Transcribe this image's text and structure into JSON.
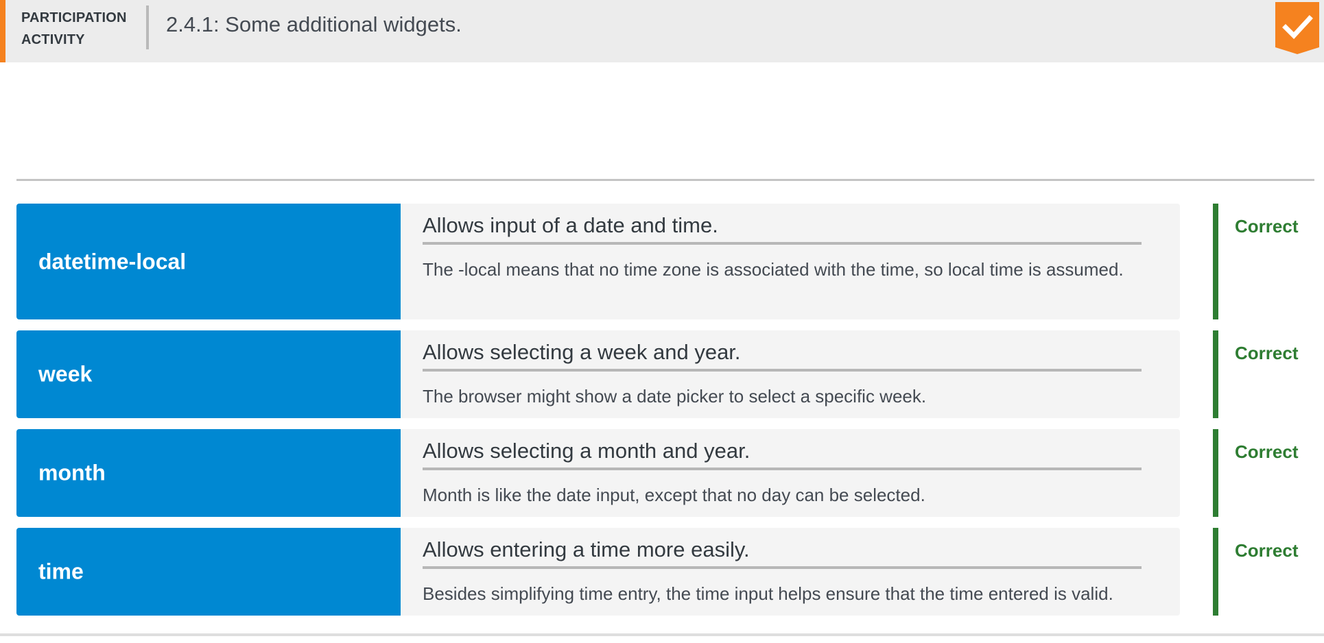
{
  "header": {
    "activity_label": "PARTICIPATION ACTIVITY",
    "title": "2.4.1: Some additional widgets.",
    "completion_icon": "checkmark-icon",
    "accent_color": "#f5821f"
  },
  "colors": {
    "term_background": "#0088d2",
    "definition_background": "#f4f4f4",
    "correct": "#2e7d32"
  },
  "matches": [
    {
      "term": "datetime-local",
      "definition": "Allows input of a date and time.",
      "explanation": "The -local means that no time zone is associated with the time, so local time is assumed.",
      "status": "Correct"
    },
    {
      "term": "week",
      "definition": "Allows selecting a week and year.",
      "explanation": "The browser might show a date picker to select a specific week.",
      "status": "Correct"
    },
    {
      "term": "month",
      "definition": "Allows selecting a month and year.",
      "explanation": "Month is like the date input, except that no day can be selected.",
      "status": "Correct"
    },
    {
      "term": "time",
      "definition": "Allows entering a time more easily.",
      "explanation": "Besides simplifying time entry, the time input helps ensure that the time entered is valid.",
      "status": "Correct"
    }
  ]
}
